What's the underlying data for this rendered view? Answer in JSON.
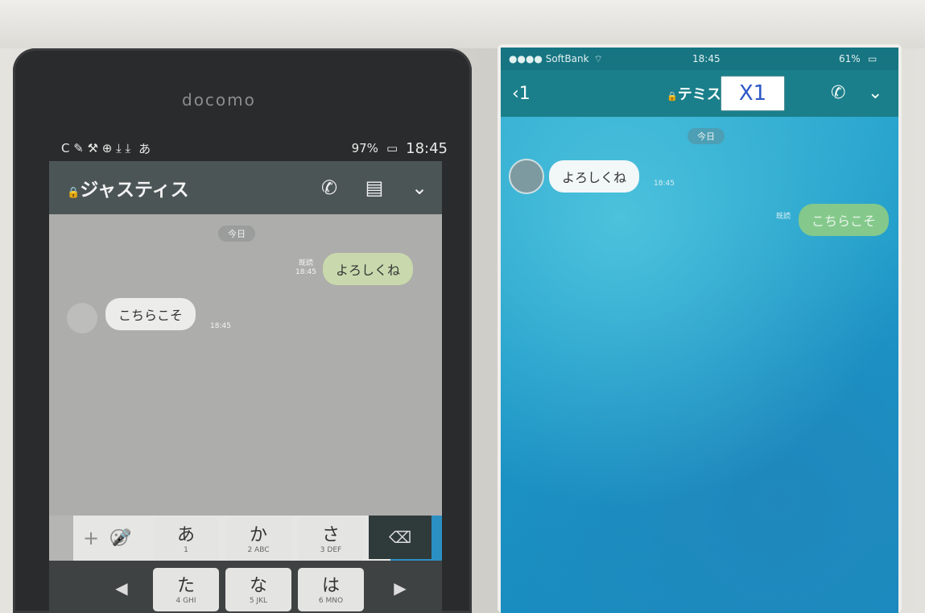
{
  "left_phone": {
    "carrier": "docomo",
    "status": {
      "icons_left": "C ✎ ⚒ ⊕ ⤓ ⤓",
      "ime": "あ",
      "battery": "97%",
      "time": "18:45"
    },
    "header": {
      "title": "ジャスティス",
      "call_icon": "phone-icon",
      "menu_icon": "note-icon",
      "more_icon": "chevron-down-icon"
    },
    "chat": {
      "date_label": "今日",
      "sent": {
        "text": "よろしくね",
        "read_label": "既読",
        "time": "18:45"
      },
      "received": {
        "text": "こちらこそ",
        "time": "18:45"
      }
    },
    "input": {
      "plus": "+",
      "emoji": "☺"
    },
    "keyboard": {
      "row1": [
        {
          "kana": "あ",
          "sub": "1"
        },
        {
          "kana": "か",
          "sub": "2 ABC"
        },
        {
          "kana": "さ",
          "sub": "3 DEF"
        }
      ],
      "row2": [
        {
          "kana": "た",
          "sub": "4 GHI"
        },
        {
          "kana": "な",
          "sub": "5 JKL"
        },
        {
          "kana": "は",
          "sub": "6 MNO"
        }
      ],
      "mic": "🎤",
      "backspace": "⌫",
      "left": "◀",
      "right": "▶"
    }
  },
  "right_phone": {
    "status": {
      "carrier": "●●●● SoftBank",
      "wifi": "⌔",
      "time": "18:45",
      "battery": "61%"
    },
    "header": {
      "back": "‹1",
      "title": "テミス",
      "redaction": "X1",
      "call_icon": "phone-icon",
      "more_icon": "chevron-down-icon"
    },
    "chat": {
      "date_label": "今日",
      "received": {
        "text": "よろしくね",
        "time": "18:45"
      },
      "sent": {
        "read_label": "既読",
        "text": "こちらこそ"
      }
    }
  },
  "colors": {
    "android_header": "#4c5556",
    "line_green_bubble": "#84c98b",
    "iphone_header": "#1a7f8a",
    "send_button": "#2c8fc4"
  }
}
